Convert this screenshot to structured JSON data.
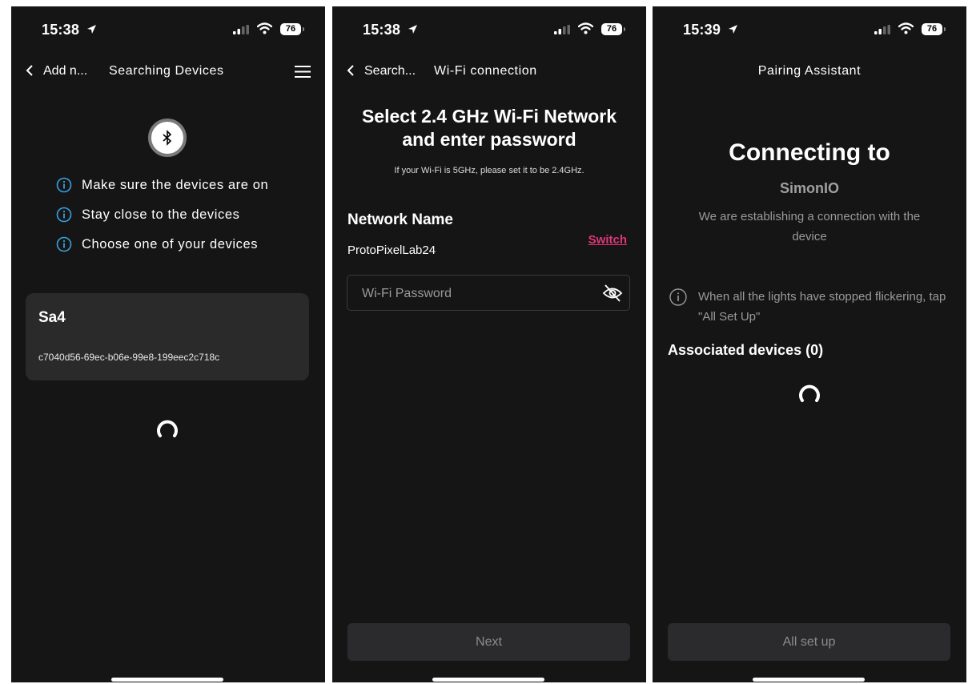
{
  "screens": [
    {
      "status": {
        "time": "15:38",
        "battery": "76"
      },
      "nav": {
        "back_label": "Add n...",
        "title": "Searching Devices"
      },
      "tips": [
        "Make sure the devices are on",
        "Stay close to the devices",
        "Choose one of your devices"
      ],
      "device": {
        "name": "Sa4",
        "id": "c7040d56-69ec-b06e-99e8-199eec2c718c"
      }
    },
    {
      "status": {
        "time": "15:38",
        "battery": "76"
      },
      "nav": {
        "back_label": "Search...",
        "title": "Wi-Fi connection"
      },
      "headline": "Select 2.4 GHz Wi-Fi Network and enter password",
      "subnote": "If your Wi-Fi is 5GHz, please set it to be 2.4GHz.",
      "network_label": "Network Name",
      "network_value": "ProtoPixelLab24",
      "switch_label": "Switch",
      "password_placeholder": "Wi-Fi Password",
      "next_label": "Next"
    },
    {
      "status": {
        "time": "15:39",
        "battery": "76"
      },
      "nav": {
        "title": "Pairing Assistant"
      },
      "title": "Connecting to",
      "device_name": "SimonIO",
      "description": "We are establishing a connection with the device",
      "note": "When all the lights have stopped flickering, tap \"All Set Up\"",
      "associated": "Associated devices (0)",
      "button_label": "All set up"
    }
  ],
  "colors": {
    "background": "#151515",
    "card": "#2a2a2a",
    "accent_link": "#e0357a",
    "info_icon": "#3aa0e0",
    "button_disabled": "#2b2b2e"
  }
}
